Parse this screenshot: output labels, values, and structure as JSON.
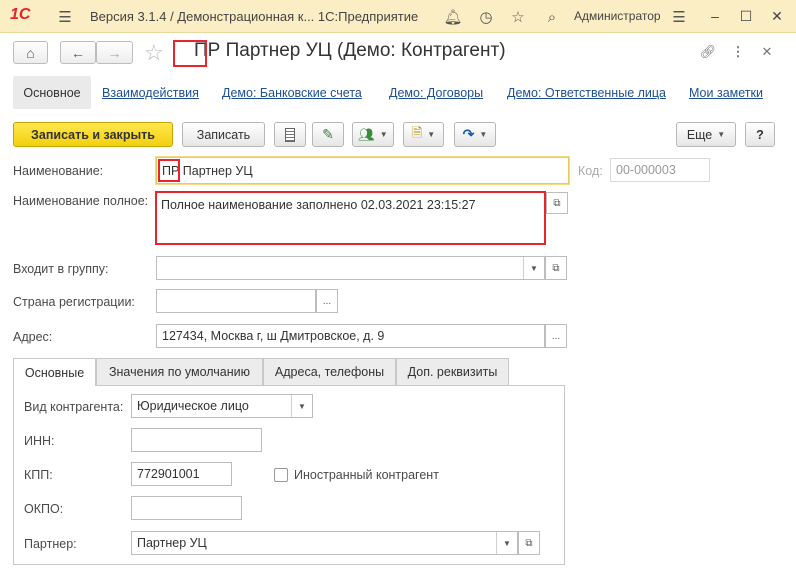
{
  "app": {
    "logo": "1С",
    "title": "Версия 3.1.4 / Демонстрационная к... 1С:Предприятие",
    "user": "Администратор"
  },
  "header": {
    "form_title_prefix": "ПР",
    "form_title_rest": " Партнер УЦ (Демо: Контрагент)"
  },
  "nav": {
    "active_tab": "Основное",
    "links": [
      "Взаимодействия",
      "Демо: Банковские счета",
      "Демо: Договоры",
      "Демо: Ответственные лица",
      "Мои заметки"
    ]
  },
  "toolbar": {
    "save_close": "Записать и закрыть",
    "save": "Записать",
    "more": "Еще",
    "help": "?"
  },
  "form": {
    "name_label": "Наименование:",
    "name_prefix": "ПР",
    "name_value": " Партнер УЦ",
    "code_label": "Код:",
    "code_value": "00-000003",
    "fullname_label": "Наименование полное:",
    "fullname_value": "Полное наименование заполнено 02.03.2021 23:15:27",
    "group_label": "Входит в группу:",
    "group_value": "",
    "country_label": "Страна регистрации:",
    "country_value": "",
    "address_label": "Адрес:",
    "address_value": "127434, Москва г, ш Дмитровское, д. 9"
  },
  "tabs": [
    "Основные",
    "Значения по умолчанию",
    "Адреса, телефоны",
    "Доп. реквизиты"
  ],
  "main_tab": {
    "type_label": "Вид контрагента:",
    "type_value": "Юридическое лицо",
    "inn_label": "ИНН:",
    "inn_value": "",
    "kpp_label": "КПП:",
    "kpp_value": "772901001",
    "foreign_label": "Иностранный контрагент",
    "okpo_label": "ОКПО:",
    "okpo_value": "",
    "partner_label": "Партнер:",
    "partner_value": "Партнер УЦ"
  },
  "colors": {
    "titlebar": "#fbeec4",
    "primary_button": "#f3cf0f",
    "highlight": "#e8242c",
    "link": "#1d4f91",
    "logo": "#e3242b"
  }
}
